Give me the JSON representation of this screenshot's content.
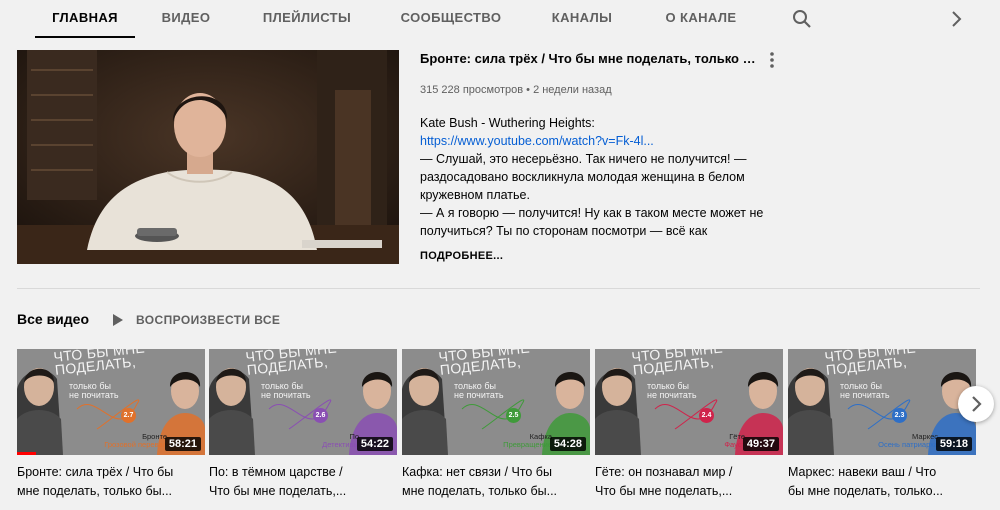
{
  "tabs": [
    {
      "label": "Главная",
      "active": true
    },
    {
      "label": "Видео"
    },
    {
      "label": "Плейлисты"
    },
    {
      "label": "Сообщество"
    },
    {
      "label": "Каналы"
    },
    {
      "label": "О канале"
    }
  ],
  "featured": {
    "title": "Бронте: сила трёх / Что бы мне поделать, только бы не почитать",
    "views": "315 228 просмотров",
    "separator": "•",
    "age": "2 недели назад",
    "desc_lines": [
      "Kate Bush - Wuthering Heights:",
      "https://www.youtube.com/watch?v=Fk-4l...",
      "",
      "— Слушай, это несерьёзно. Так ничего не получится! —",
      "раздосадовано воскликнула молодая женщина в белом",
      "кружевном платье.",
      "— А я говорю — получится! Ну как в таком месте может не",
      "получиться? Ты по сторонам посмотри — всё как"
    ],
    "more_label": "ПОДРОБНЕЕ..."
  },
  "shelf": {
    "title": "Все видео",
    "play_all": "ВОСПРОИЗВЕСТИ ВСЕ",
    "videos": [
      {
        "title_l1": "Бронте: сила трёх / Что бы",
        "title_l2": "мне поделать, только бы...",
        "duration": "58:21",
        "num": "2.7",
        "cap1": "Бронте",
        "cap2": "Грозовой перевал",
        "accent": "#e0712b",
        "progress": 0.1
      },
      {
        "title_l1": "По: в тёмном царстве /",
        "title_l2": "Что бы мне поделать,...",
        "duration": "54:22",
        "num": "2.6",
        "cap1": "По",
        "cap2": "Детективы",
        "accent": "#8a4fb3",
        "progress": 0
      },
      {
        "title_l1": "Кафка: нет связи / Что бы",
        "title_l2": "мне поделать, только бы...",
        "duration": "54:28",
        "num": "2.5",
        "cap1": "Кафка",
        "cap2": "Превращение",
        "accent": "#3f9a3a",
        "progress": 0
      },
      {
        "title_l1": "Гёте: он познавал мир /",
        "title_l2": "Что бы мне поделать,...",
        "duration": "49:37",
        "num": "2.4",
        "cap1": "Гёте",
        "cap2": "Фауст",
        "accent": "#d0234b",
        "progress": 0
      },
      {
        "title_l1": "Маркес: навеки ваш / Что",
        "title_l2": "бы мне поделать, только...",
        "duration": "59:18",
        "num": "2.3",
        "cap1": "Маркес",
        "cap2": "Осень патриарха",
        "accent": "#2e6fc7",
        "progress": 0
      }
    ],
    "thumb_overlay": [
      "ЧТО БЫ МНЕ",
      "ПОДЕЛАТЬ,",
      "только бы",
      "не почитать"
    ]
  }
}
